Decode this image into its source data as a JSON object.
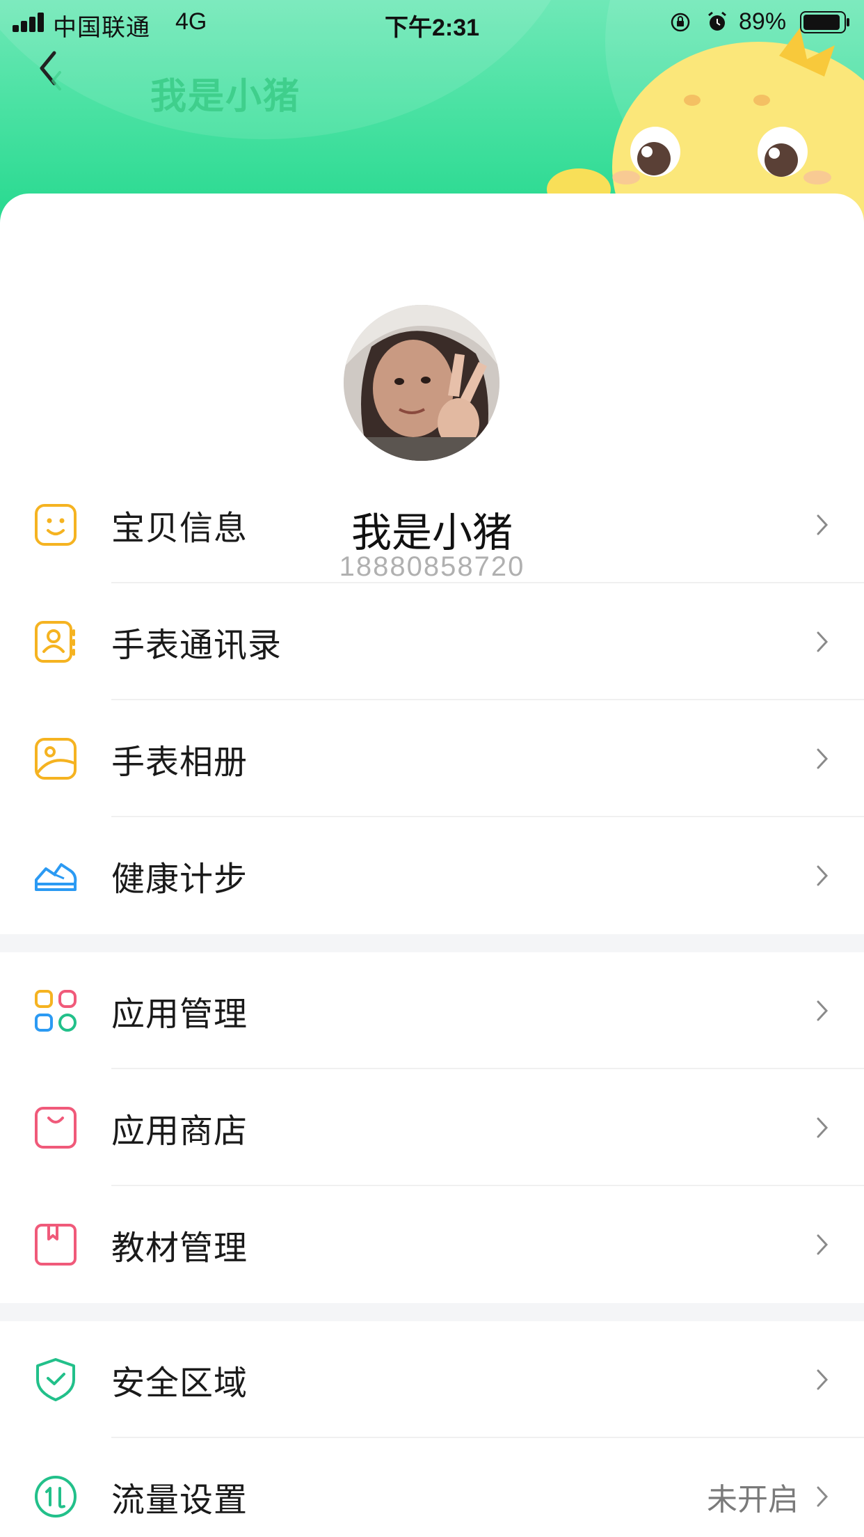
{
  "status_bar": {
    "carrier": "中国联通",
    "network": "4G",
    "time": "下午2:31",
    "battery": "89%"
  },
  "nav": {
    "title": "我是小猪"
  },
  "profile": {
    "name": "我是小猪",
    "phone": "18880858720"
  },
  "sections": [
    {
      "items": [
        {
          "label": "宝贝信息",
          "icon": "smile-face-icon"
        },
        {
          "label": "手表通讯录",
          "icon": "contacts-book-icon"
        },
        {
          "label": "手表相册",
          "icon": "photo-album-icon"
        },
        {
          "label": "健康计步",
          "icon": "sneaker-icon"
        }
      ]
    },
    {
      "items": [
        {
          "label": "应用管理",
          "icon": "apps-grid-icon"
        },
        {
          "label": "应用商店",
          "icon": "shopping-bag-icon"
        },
        {
          "label": "教材管理",
          "icon": "textbook-icon"
        }
      ]
    },
    {
      "items": [
        {
          "label": "安全区域",
          "icon": "shield-check-icon"
        },
        {
          "label": "流量设置",
          "icon": "data-traffic-icon",
          "value": "未开启"
        }
      ]
    }
  ],
  "colors": {
    "header_green": "#27d98f",
    "title_green": "#3fcf8c",
    "icon_yellow": "#f5b321",
    "icon_blue": "#2b9af3",
    "icon_red": "#f05a7a",
    "icon_green": "#22c08a"
  }
}
